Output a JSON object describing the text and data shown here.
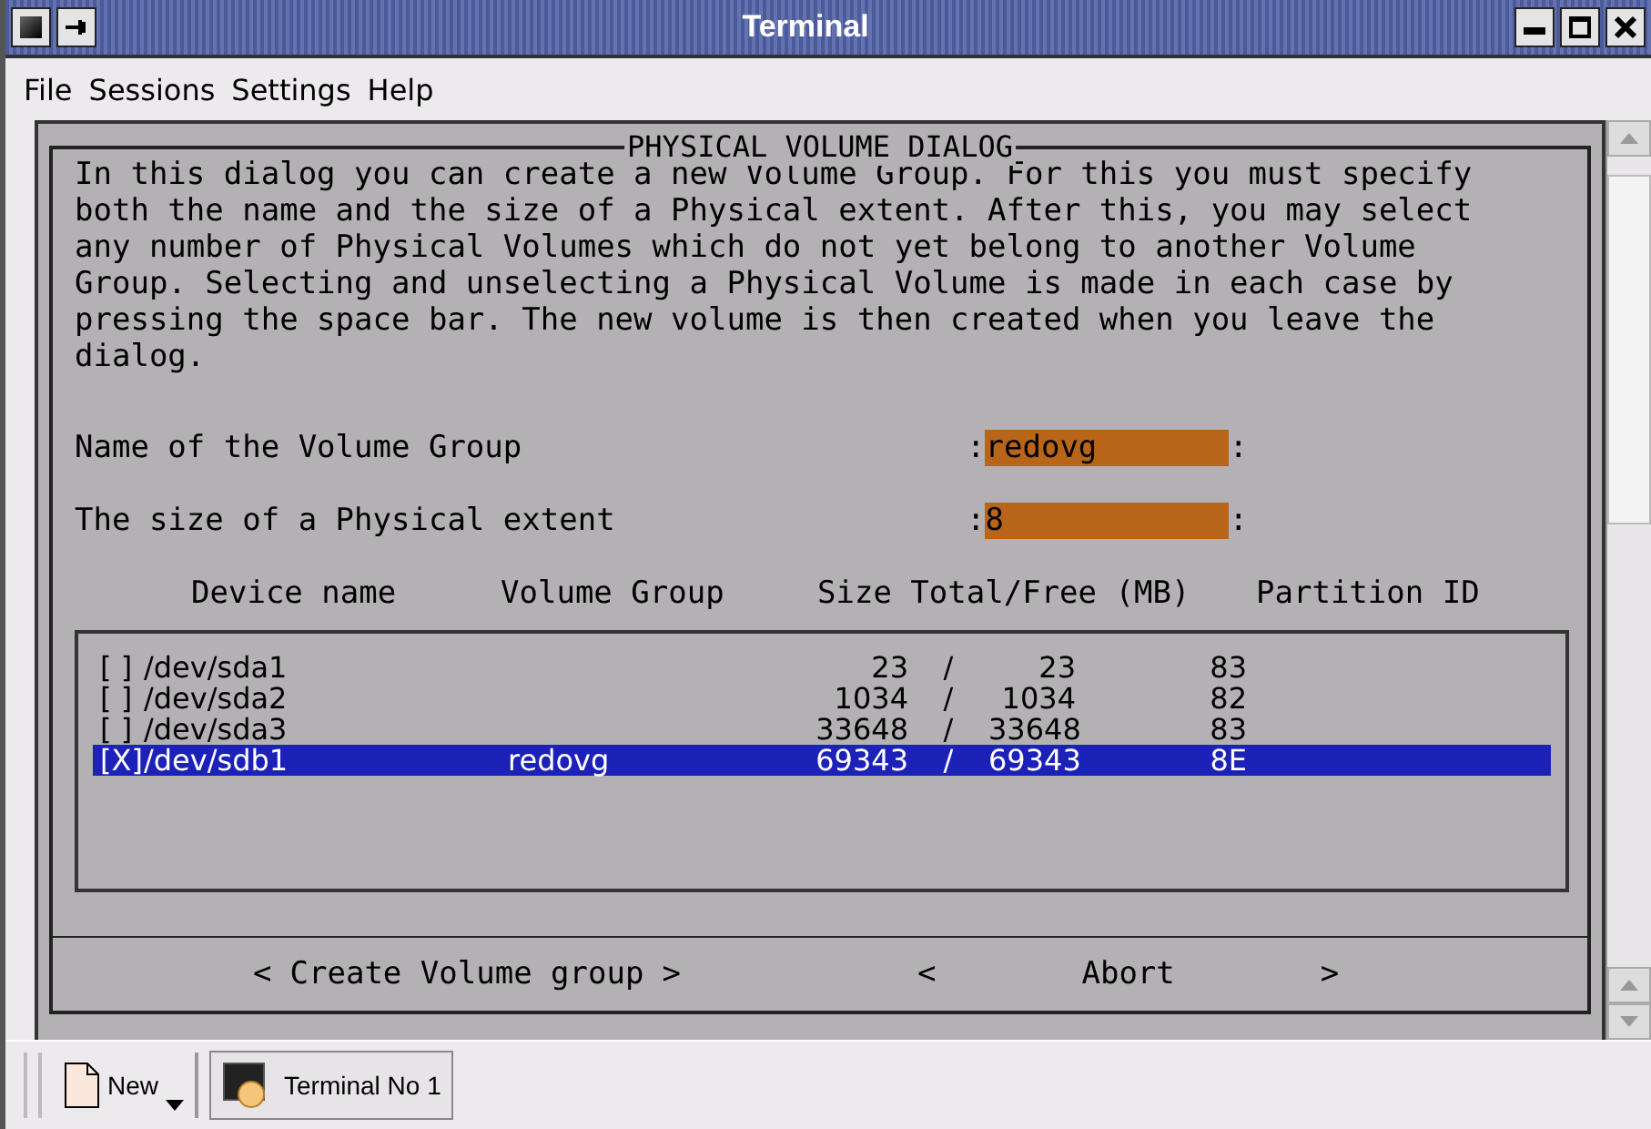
{
  "window": {
    "title": "Terminal"
  },
  "menu": [
    "File",
    "Sessions",
    "Settings",
    "Help"
  ],
  "dialog": {
    "title": "PHYSICAL VOLUME DIALOG",
    "description": "In this dialog you can create a new Volume Group. For this you must specify both the name and the size of a Physical extent. After this, you may select any number of Physical Volumes which do not yet belong to another Volume Group. Selecting and unselecting a Physical Volume is made in each case by pressing the space bar. The new volume is then created when you leave the dialog.",
    "fields": [
      {
        "label": "Name of the Volume Group",
        "open": ":",
        "value": "redovg",
        "close": ":"
      },
      {
        "label": "The size of a Physical extent",
        "open": ":",
        "value": "8",
        "close": ":"
      }
    ],
    "columns": [
      "Device name",
      "Volume Group",
      "Size Total/Free (MB)",
      "Partition ID"
    ],
    "rows": [
      {
        "mark": "[ ]",
        "device": "/dev/sda1",
        "volume_group": "",
        "total": "23",
        "separator": "/",
        "free": "23",
        "partition_id": "83",
        "selected": false
      },
      {
        "mark": "[ ]",
        "device": "/dev/sda2",
        "volume_group": "",
        "total": "1034",
        "separator": "/",
        "free": "1034",
        "partition_id": "82",
        "selected": false
      },
      {
        "mark": "[ ]",
        "device": "/dev/sda3",
        "volume_group": "",
        "total": "33648",
        "separator": "/",
        "free": "33648",
        "partition_id": "83",
        "selected": false
      },
      {
        "mark": "[X]",
        "device": "/dev/sdb1",
        "volume_group": "redovg",
        "total": "69343",
        "separator": "/",
        "free": "69343",
        "partition_id": "8E",
        "selected": true
      }
    ],
    "buttons": [
      {
        "open": "<",
        "label": "Create Volume group",
        "close": ">",
        "kind": "tight"
      },
      {
        "open": "<",
        "label": "Abort",
        "close": ">",
        "kind": "wide"
      }
    ]
  },
  "taskbar": [
    {
      "label": "New",
      "kind": "new"
    },
    {
      "label": "Terminal No 1",
      "kind": "terminal"
    }
  ]
}
